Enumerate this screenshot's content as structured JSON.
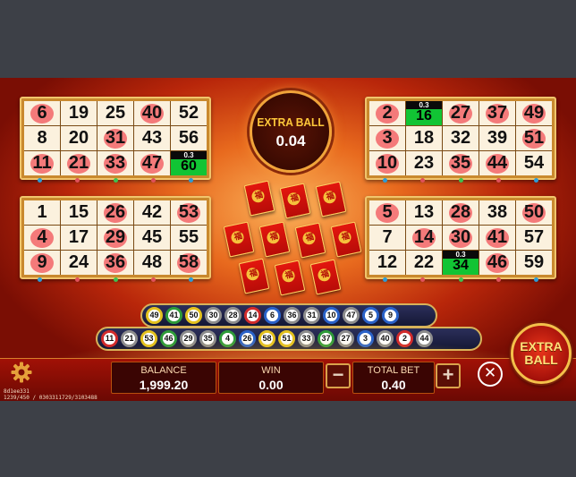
{
  "cards": [
    {
      "id": "card-top-left",
      "rows": [
        [
          6,
          19,
          25,
          40,
          52
        ],
        [
          8,
          20,
          31,
          43,
          56
        ],
        [
          11,
          21,
          33,
          47,
          {
            "bonus": "0.3",
            "value": 60
          }
        ]
      ],
      "hits": [
        6,
        40,
        31,
        11,
        21,
        33,
        47
      ]
    },
    {
      "id": "card-bottom-left",
      "rows": [
        [
          1,
          15,
          26,
          42,
          53
        ],
        [
          4,
          17,
          29,
          45,
          55
        ],
        [
          9,
          24,
          36,
          48,
          58
        ]
      ],
      "hits": [
        26,
        53,
        4,
        29,
        9,
        36,
        58
      ]
    },
    {
      "id": "card-top-right",
      "rows": [
        [
          2,
          {
            "bonus": "0.3",
            "value": 16
          },
          27,
          37,
          49
        ],
        [
          3,
          18,
          32,
          39,
          51
        ],
        [
          10,
          23,
          35,
          44,
          54
        ]
      ],
      "hits": [
        2,
        27,
        37,
        49,
        3,
        51,
        10,
        35,
        44
      ]
    },
    {
      "id": "card-bottom-right",
      "rows": [
        [
          5,
          13,
          28,
          38,
          50
        ],
        [
          7,
          14,
          30,
          41,
          57
        ],
        [
          12,
          22,
          {
            "bonus": "0.3",
            "value": 34
          },
          46,
          59
        ]
      ],
      "hits": [
        5,
        28,
        50,
        14,
        30,
        41,
        46
      ]
    }
  ],
  "extra_ball_meter": {
    "label": "EXTRA BALL",
    "value": "0.04"
  },
  "envelope_glyph": "福",
  "drawn_balls": {
    "row1": [
      49,
      41,
      50,
      30,
      28,
      14,
      6,
      36,
      31,
      10,
      47,
      5,
      9
    ],
    "row2": [
      11,
      21,
      53,
      46,
      29,
      35,
      4,
      26,
      58,
      51,
      33,
      37,
      27,
      3,
      40,
      2,
      44
    ]
  },
  "ball_colors": {
    "red": "#d22b2b",
    "blue": "#2a62c9",
    "green": "#2e9b39",
    "yellow": "#e3c11e",
    "gray": "#8d8d8d",
    "black": "#1f1f1f"
  },
  "extra_ball_button": {
    "label": "EXTRA\nBALL"
  },
  "bottom_bar": {
    "balance_label": "BALANCE",
    "balance_value": "1,999.20",
    "win_label": "WIN",
    "win_value": "0.00",
    "total_bet_label": "TOTAL BET",
    "total_bet_value": "0.40",
    "minus_label": "−",
    "plus_label": "+",
    "close_label": "✕"
  },
  "meta": {
    "id_line": "8d1ee331",
    "info_line": "1239/450 / 0303311729/3103488"
  }
}
